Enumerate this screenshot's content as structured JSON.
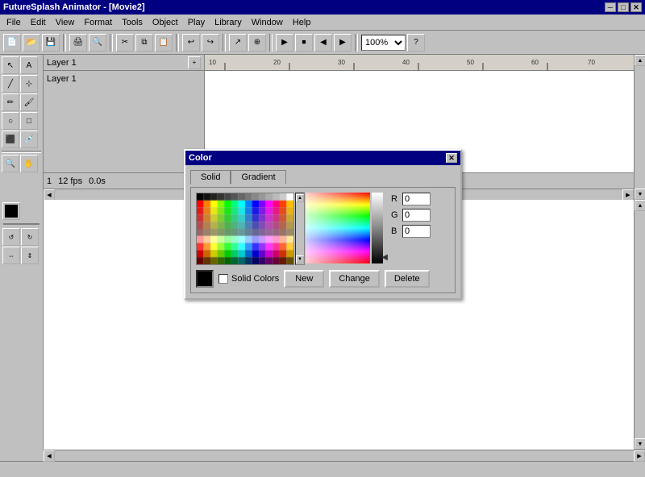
{
  "app": {
    "title": "FutureSplash Animator - [Movie2]",
    "close_btn": "✕",
    "minimize_btn": "─",
    "maximize_btn": "□"
  },
  "menu": {
    "items": [
      "File",
      "Edit",
      "View",
      "Format",
      "Tools",
      "Object",
      "Play",
      "Library",
      "Window",
      "Help"
    ]
  },
  "toolbar": {
    "zoom_value": "100%",
    "help_icon": "?"
  },
  "timeline": {
    "layer_name": "Layer 1",
    "frame_number": "1",
    "fps": "12 fps",
    "time": "0.0s"
  },
  "color_dialog": {
    "title": "Color",
    "tabs": [
      "Solid",
      "Gradient"
    ],
    "active_tab": "Solid",
    "rgb": {
      "r_label": "R",
      "g_label": "G",
      "b_label": "B",
      "r_value": "0",
      "g_value": "0",
      "b_value": "0"
    },
    "solid_colors_label": "Solid Colors",
    "buttons": {
      "new": "New",
      "change": "Change",
      "delete": "Delete"
    }
  },
  "status": {
    "text": ""
  }
}
